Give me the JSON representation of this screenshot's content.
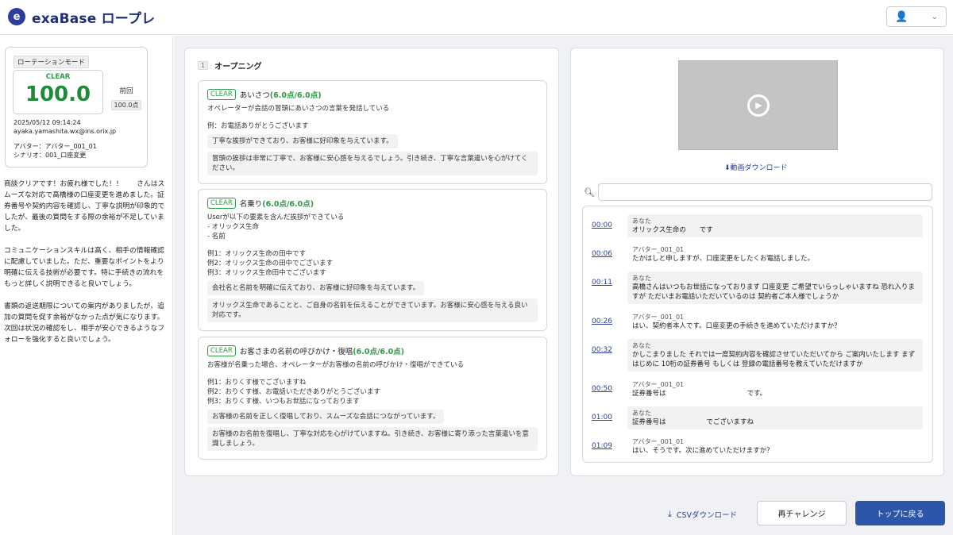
{
  "header": {
    "brand": "exaBase ロープレ",
    "logo_glyph": "e",
    "user_icon": "👤",
    "chevron": "⌄"
  },
  "sidebar": {
    "mode_tag": "ローテーションモード",
    "status": "CLEAR",
    "score": "100.0",
    "prev_label": "前回",
    "prev_value": "100.0点",
    "date": "2025/05/12 09:14:24",
    "email": "ayaka.yamashita.wx@ins.orix.jp",
    "avatar": "アバター：アバター_001_01",
    "scenario": "シナリオ：001_口座変更",
    "summary": [
      "商談クリアです！お疲れ様でした！！　　さんはスムーズな対応で高橋様の口座変更を進めました。証券番号や契約内容を確認し、丁寧な説明が印象的でしたが、最後の質問をする際の余裕が不足していました。",
      "コミュニケーションスキルは高く、相手の情報確認に配慮していました。ただ、重要なポイントをより明確に伝える技術が必要です。特に手続きの流れをもっと詳しく説明できると良いでしょう。",
      "書類の返送期限についての案内がありましたが、追加の質問を促す余裕がなかった点が気になります。次回は状況の確認をし、相手が安心できるようなフォローを強化すると良いでしょう。"
    ]
  },
  "evaluation": {
    "section_num": "1",
    "section_title": "オープニング",
    "criteria": [
      {
        "badge": "CLEAR",
        "title": "あいさつ",
        "points": "(6.0点/6.0点)",
        "desc": "オペレーターが会話の冒頭にあいさつの言葉を発話している",
        "examples": "例：お電話ありがとうございます",
        "fb1": "丁寧な挨拶ができており、お客様に好印象を与えています。",
        "fb2": "冒頭の挨拶は非常に丁寧で、お客様に安心感を与えるでしょう。引き続き、丁寧な言葉遣いを心がけてください。"
      },
      {
        "badge": "CLEAR",
        "title": "名乗り",
        "points": "(6.0点/6.0点)",
        "desc": "Userが以下の要素を含んだ挨拶ができている\n- オリックス生命\n- 名前",
        "examples": "例1：オリックス生命の田中です\n例2：オリックス生命の田中でございます\n例3：オリックス生命田中でございます",
        "fb1": "会社名と名前を明確に伝えており、お客様に好印象を与えています。",
        "fb2": "オリックス生命であることと、ご自身の名前を伝えることができています。お客様に安心感を与える良い対応です。"
      },
      {
        "badge": "CLEAR",
        "title": "お客さまの名前の呼びかけ・復唱",
        "points": "(6.0点/6.0点)",
        "desc": "お客様が名乗った場合、オペレーターがお客様の名前の呼びかけ・復唱ができている",
        "examples": "例1：おりくす様でございますね\n例2：おりくす様、お電話いただきありがとうございます\n例3：おりくす様、いつもお世話になっております",
        "fb1": "お客様の名前を正しく復唱しており、スムーズな会話につながっています。",
        "fb2": "お客様のお名前を復唱し、丁寧な対応を心がけていますね。引き続き、お客様に寄り添った言葉遣いを意識しましょう。"
      }
    ]
  },
  "media": {
    "download_video": "⬇動画ダウンロード",
    "search_placeholder": "",
    "search_value": "",
    "transcript": [
      {
        "time": "00:00",
        "speaker": "あなた",
        "text": "オリックス生命の　　です",
        "role": "user"
      },
      {
        "time": "00:06",
        "speaker": "アバター_001_01",
        "text": "たかはしと申しますが、口座変更をしたくお電話しました。",
        "role": "avatar"
      },
      {
        "time": "00:11",
        "speaker": "あなた",
        "text": "高橋さんはいつもお世話になっております 口座変更 ご希望でいらっしゃいますね 恐れ入りますが ただいまお電話いただいているのは 契約者ご本人様でしょうか",
        "role": "user"
      },
      {
        "time": "00:26",
        "speaker": "アバター_001_01",
        "text": "はい、契約者本人です。口座変更の手続きを進めていただけますか？",
        "role": "avatar"
      },
      {
        "time": "00:32",
        "speaker": "あなた",
        "text": "かしこまりました それでは一度契約内容を確認させていただいてから ご案内いたします まずはじめに 10桁の証券番号 もしくは 登録の電話番号を教えていただけますか",
        "role": "user"
      },
      {
        "time": "00:50",
        "speaker": "アバター_001_01",
        "text": "証券番号は　　　　　　　　　　　　です。",
        "role": "avatar"
      },
      {
        "time": "01:00",
        "speaker": "あなた",
        "text": "証券番号は　　　　　　でございますね",
        "role": "user"
      },
      {
        "time": "01:09",
        "speaker": "アバター_001_01",
        "text": "はい、そうです。次に進めていただけますか？",
        "role": "avatar"
      }
    ]
  },
  "actions": {
    "csv_label": "CSVダウンロード",
    "retry_label": "再チャレンジ",
    "top_label": "トップに戻る"
  },
  "colors": {
    "brand": "#1f2d7a",
    "clear_green": "#2e9b47",
    "primary_button": "#2c56a8",
    "link": "#2a3f9b"
  }
}
